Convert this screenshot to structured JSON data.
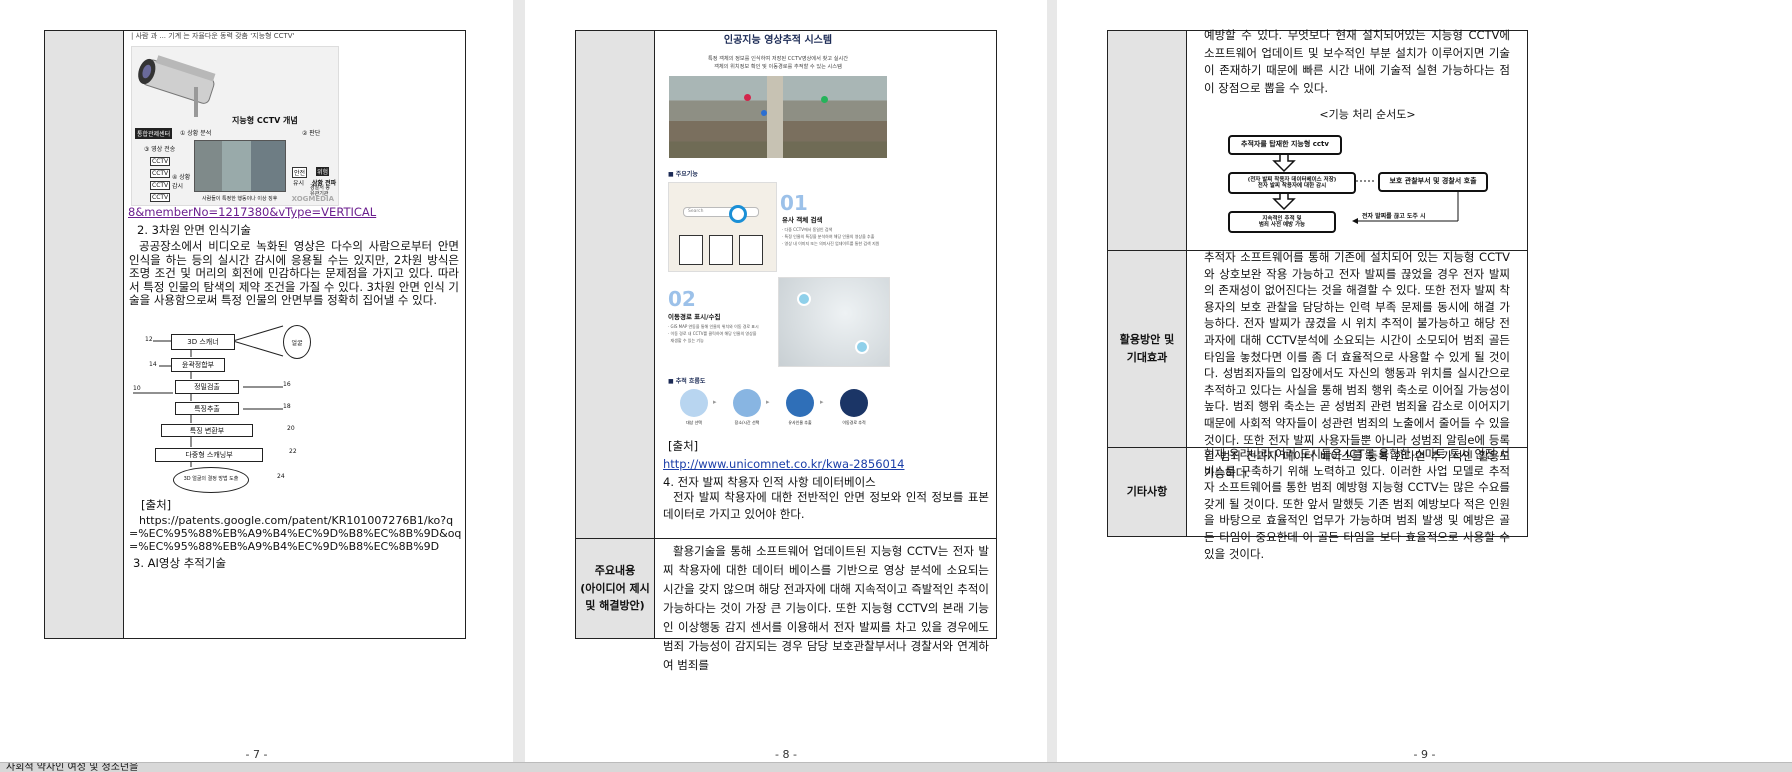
{
  "pages": [
    {
      "number": "- 7 -",
      "cctv_caption": "| 사람 과 ... 기계 는 자율다운 동력 갖춤 '지능형 CCTV'",
      "cctv_figure": {
        "title": "지능형 CCTV 개념",
        "center": "통합관제센터",
        "step1": "① 상황 분석",
        "step2": "② 판단",
        "step3": "③ 영상 전송",
        "step4": "④ 상황 감시",
        "cams": [
          "CCTV",
          "CCTV",
          "CCTV",
          "CCTV"
        ],
        "safe": "안전",
        "danger": "위험",
        "safe_sub": "유시",
        "danger_sub": "상황 전파",
        "danger_sub2": "경찰서 등 유관기관",
        "bottom_caption": "사람들이 특정한 행동이나 이상 징후",
        "brand": "XOGMEDIA"
      },
      "link_url": "8&memberNo=1217380&vType=VERTICAL",
      "section2_title": "2. 3차원 안면 인식기술",
      "section2_body": "공공장소에서 비디오로 녹화된 영상은 다수의 사람으로부터 안면 인식을 하는 등의 실시간 감시에 응용될 수는 있지만, 2차원 방식은 조명 조건 및 머리의 회전에 민감하다는 문제점을 가지고 있다. 따라서 특정 인물의 탐색의 제약 조건을 가질 수 있다. 3차원 안면 인식 기술을 사용함으로써 특정 인물의 안면부를 정확히 집어낼 수 있다.",
      "diagram": {
        "nodes": [
          "3D 스캐너",
          "얼굴",
          "윤곽정합부",
          "정밀검출",
          "특징추출",
          "특징 변환부",
          "다중형 스캐닝부",
          "3D 얼굴의 결정 방법 도출"
        ],
        "refs": [
          "12",
          "14",
          "10",
          "16",
          "18",
          "20",
          "22",
          "24"
        ]
      },
      "source_label": "[출처]",
      "source_url": "https://patents.google.com/patent/KR101007276B1/ko?q=%EC%95%88%EB%A9%B4%EC%9D%B8%EC%8B%9D&oq=%EC%95%88%EB%A9%B4%EC%9D%B8%EC%8B%9D",
      "section3_title": "3. AI영상 추적기술"
    },
    {
      "number": "- 8 -",
      "poster": {
        "title": "인공지능 영상추적 시스템",
        "subtitle1": "특정 객체의 정보를 인식하여 저장된 CCTV영상에서 찾고 실시간",
        "subtitle2": "객체의 위치정보 확인 및 이동경로를 추적할 수 있는 시스템",
        "section_main": "주요기능",
        "feat1_num": "01",
        "feat1_title": "유사 객체 검색",
        "feat1_lines": [
          "· 다중 CCTV에서 동일인 검색",
          "· 특정 인물의 특징을 분석하여 해당 인물의 영상을 추출",
          "· 영상 내 이미지 또는 의미사진 업데이트를 통한 검색 지원"
        ],
        "search_placeholder": "Search",
        "feat2_num": "02",
        "feat2_title": "이동경로 표시/수집",
        "feat2_lines": [
          "· GIS MAP 연동을 통해 인물의 위치와 이동 경로 표시",
          "· 이동 경로 내 CCTV를 클릭하여 해당 인물의 영상을",
          "  재생할 수 있는 기능"
        ],
        "section_flow": "추적 흐름도",
        "flow": [
          "대상 선택",
          "장소/시간 선택",
          "유사인물 추출",
          "이동경로 추적"
        ]
      },
      "source_label": "[출처]",
      "source_url": "http://www.unicomnet.co.kr/kwa-2856014",
      "item4_title": "4. 전자 발찌 착용자 인적 사항 데이터베이스",
      "item4_body": "전자 발찌 착용자에 대한 전반적인 안면 정보와 인적 정보를 표본 데이터로 가지고 있어야 한다.",
      "label_main": "주요내용\n(아이디어 제시\n및 해결방안)",
      "main_body": "활용기술을 통해 소프트웨어 업데이트된 지능형 CCTV는 전자 발찌 착용자에 대한 데이터 베이스를 기반으로 영상 분석에 소요되는 시간을 갖지 않으며 해당 전과자에 대해 지속적이고 즉발적인 추적이 가능하다는 것이 가장 큰 기능이다. 또한 지능형 CCTV의 본래 기능인 이상행동 감지 센서를 이용해서 전자 발찌를 차고 있을 경우에도 범죄 가능성이 감지되는 경우 담당 보호관찰부서나 경찰서와 연계하여 범죄를"
    },
    {
      "number": "- 9 -",
      "cont_body": "예방할 수 있다. 무엇보다 현재 설치되어있는 지능형 CCTV에 소프트웨어 업데이트 및 보수적인 부분 설치가 이루어지면 기술이 존재하기 때문에 빠른 시간 내에 기술적 실현 가능하다는 점이 장점으로 뽑을 수 있다.",
      "flow_title": "<기능 처리 순서도>",
      "flow_boxes": [
        "추적자를 탑재한 지능형 cctv",
        "(전자 발찌 착용자 데이터베이스 저장)\n전자 발찌 착용자에 대한 감시",
        "보호 관찰부서 및 경찰서 호출",
        "지속적인 추적 및\n범죄 사전 예방 가능",
        "전자 발찌를 끊고 도주 시"
      ],
      "label_use": "활용방안 및\n기대효과",
      "use_body": "추적자 소프트웨어를 통해 기존에 설치되어 있는 지능형 CCTV와 상호보완 작용 가능하고 전자 발찌를 끊었을 경우 전자 발찌의 존재성이 없어진다는 것을 해결할 수 있다. 또한 전자 발찌 착용자의 보호 관찰을 담당하는 인력 부족 문제를 동시에 해결 가능하다. 전자 발찌가 끊겼을 시 위치 추적이 불가능하고 해당 전과자에 대해 CCTV분석에 소요되는 시간이 소모되어 범죄 골든 타임을 놓쳤다면 이를 좀 더 효율적으로 사용할 수 있게 될 것이다. 성범죄자들의 입장에서도 자신의 행동과 위치를 실시간으로 추적하고 있다는 사실을 통해 범죄 행위 축소로 이어질 가능성이 높다. 범죄 행위 축소는 곧 성범죄 관련 범죄율 감소로 이어지기 때문에 사회적 약자들이 성관련 범죄의 노출에서 줄어들 수 있을 것이다. 또한 전자 발찌 사용자들뿐 아니라 성범죄 알림e에 등록된 범죄 전과자 데이터 베이스를 등록 한다면 추가적인 활용도 가능하다.",
      "label_etc": "기타사항",
      "etc_body": "현재 우리나라 여러 도시들은 ICT를 융합한 스마트 도시 안전 서비스를 구축하기 위해 노력하고 있다. 이러한 사업 모델로 추적자 소프트웨어를 통한 범죄 예방형 지능형 CCTV는 많은 수요를 갖게 될 것이다. 또한 앞서 말했듯 기존 범죄 예방보다 적은 인원을 바탕으로 효율적인 업무가 가능하며 범죄 발생 및 예방은 골든 타임이 중요한데 이 골든 타임을 보다 효율적으로 사용할 수 있을 것이다."
    }
  ],
  "statusbar_text": "사회적 약자인 여성 및 청소년을"
}
